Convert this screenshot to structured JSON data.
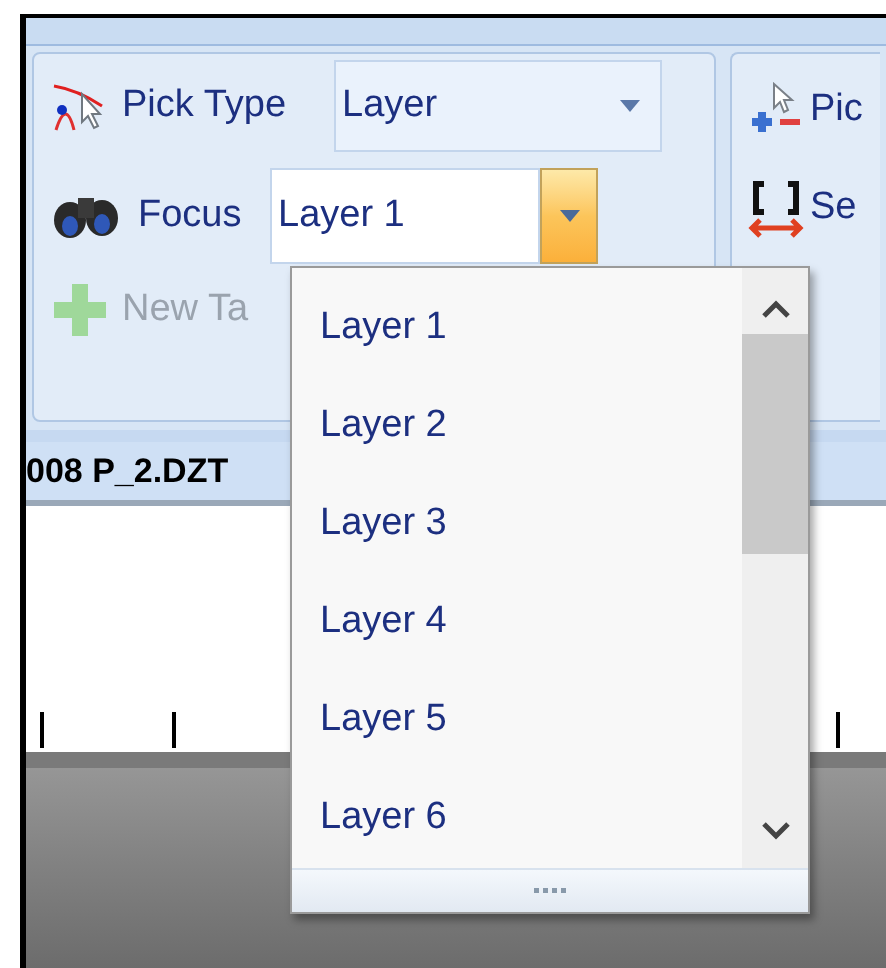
{
  "ribbon": {
    "pick_type": {
      "label": "Pick Type",
      "value": "Layer"
    },
    "focus": {
      "label": "Focus",
      "value": "Layer 1",
      "expanded": true
    },
    "new_button": {
      "label": "New Ta",
      "disabled": true
    },
    "group_2": [
      {
        "kind": "pick",
        "label": "Pic"
      },
      {
        "kind": "select",
        "label": "Se"
      }
    ]
  },
  "document_tab": {
    "title": "008 P_2.DZT"
  },
  "dropdown": {
    "items": [
      {
        "label": "Layer 1"
      },
      {
        "label": "Layer 2"
      },
      {
        "label": "Layer 3"
      },
      {
        "label": "Layer 4"
      },
      {
        "label": "Layer 5"
      },
      {
        "label": "Layer 6"
      }
    ]
  }
}
